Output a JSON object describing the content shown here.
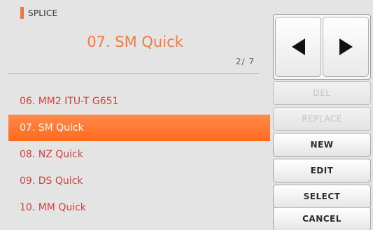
{
  "header": {
    "title": "SPLICE",
    "selected_name": "07. SM Quick",
    "page_indicator": "2/ 7"
  },
  "list": {
    "items": [
      {
        "label": "06. MM2 ITU-T G651",
        "selected": false
      },
      {
        "label": "07. SM Quick",
        "selected": true
      },
      {
        "label": "08. NZ Quick",
        "selected": false
      },
      {
        "label": "09. DS Quick",
        "selected": false
      },
      {
        "label": "10. MM Quick",
        "selected": false
      }
    ]
  },
  "nav": {
    "prev_icon": "left-triangle",
    "next_icon": "right-triangle"
  },
  "buttons": {
    "del": "DEL",
    "replace": "REPLACE",
    "new": "NEW",
    "edit": "EDIT",
    "select": "SELECT",
    "cancel": "CANCEL"
  },
  "colors": {
    "accent": "#f07a40",
    "selected_row": "#ff7228",
    "list_text": "#d04040"
  }
}
